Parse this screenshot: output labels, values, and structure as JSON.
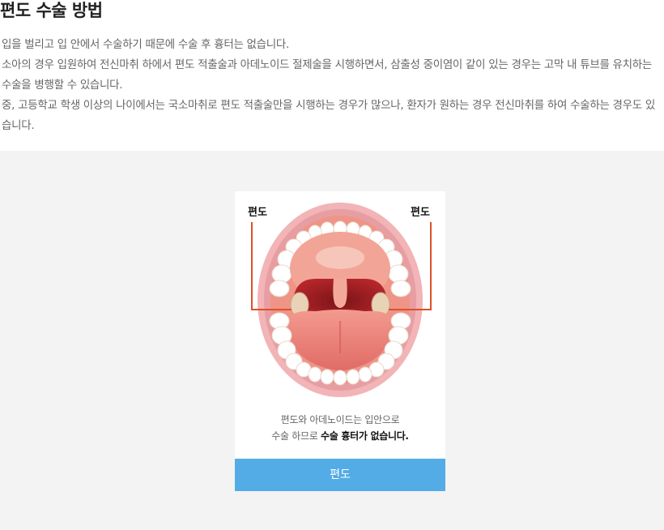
{
  "page": {
    "title": "편도 수술 방법",
    "paragraphs": [
      "입을 벌리고 입 안에서 수술하기 때문에 수술 후 흉터는 없습니다.",
      "소아의 경우 입원하여 전신마취 하에서 편도 적출술과 아데노이드 절제술을 시행하면서, 삼출성 중이염이 같이 있는 경우는 고막 내 튜브를 유치하는 수술을 병행할 수 있습니다.",
      "중, 고등학교 학생 이상의 나이에서는 국소마취로 편도 적출술만을 시행하는 경우가 많으나, 환자가 원하는 경우 전신마취를 하여 수술하는 경우도 있습니다."
    ]
  },
  "figure": {
    "label_left": "편도",
    "label_right": "편도",
    "caption_line1": "편도와 아데노이드는 입안으로",
    "caption_line2_prefix": "수술 하므로 ",
    "caption_line2_bold": "수술 흉터가 없습니다.",
    "button_label": "편도",
    "colors": {
      "accent_button": "#54ace6",
      "pointer_line": "#e0502a",
      "gray_background": "#f3f3f3"
    }
  }
}
